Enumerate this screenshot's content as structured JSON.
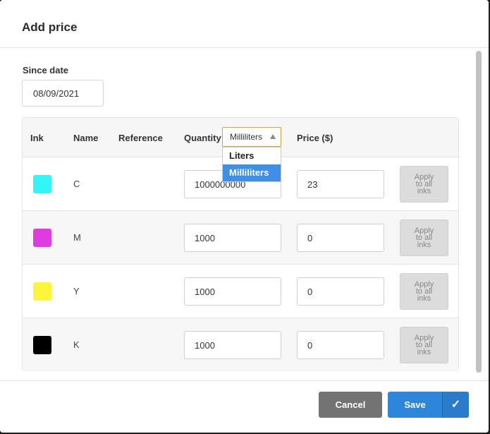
{
  "dialog": {
    "title": "Add price",
    "since_label": "Since date",
    "since_value": "08/09/2021"
  },
  "table": {
    "headers": {
      "ink": "Ink",
      "name": "Name",
      "reference": "Reference",
      "quantity": "Quantity",
      "price": "Price ($)"
    },
    "unit_select": {
      "value": "Milliliters",
      "options": [
        "Liters",
        "Milliliters"
      ],
      "selected_index": 1
    },
    "apply_label_lines": [
      "Apply",
      "to all",
      "inks"
    ],
    "rows": [
      {
        "name": "C",
        "color": "#33f5f7",
        "quantity": "1000000000",
        "price": "23"
      },
      {
        "name": "M",
        "color": "#e03be0",
        "quantity": "1000",
        "price": "0"
      },
      {
        "name": "Y",
        "color": "#fdf53a",
        "quantity": "1000",
        "price": "0"
      },
      {
        "name": "K",
        "color": "#000000",
        "quantity": "1000",
        "price": "0"
      }
    ]
  },
  "footer": {
    "cancel_label": "Cancel",
    "save_label": "Save",
    "save_icon": "✓"
  },
  "colors": {
    "accent": "#2d86d9",
    "cancel": "#737373",
    "select_border": "#d9a23a",
    "selected_option": "#3d8fe8"
  }
}
